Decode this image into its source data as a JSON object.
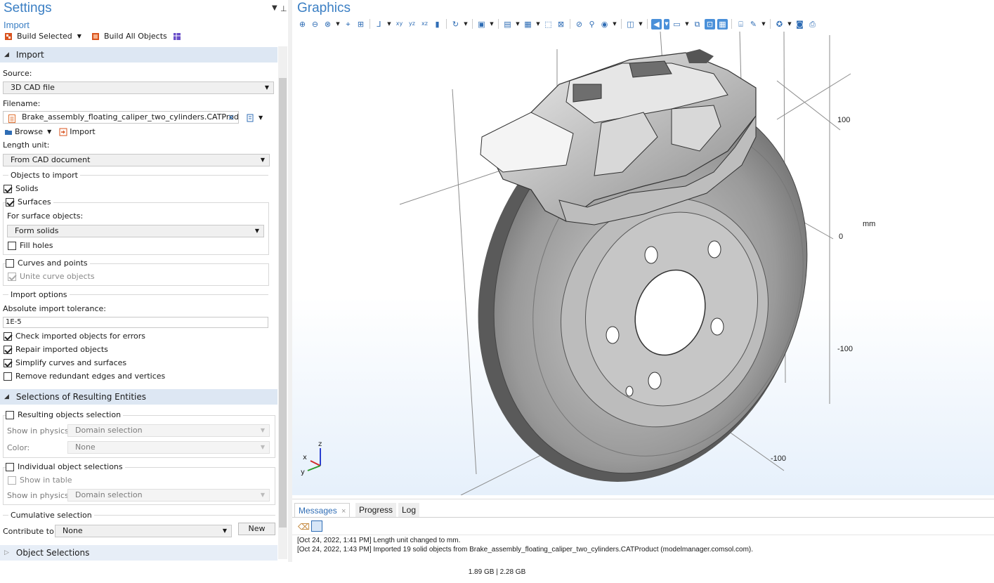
{
  "settings": {
    "title": "Settings",
    "subtitle": "Import",
    "toolbar": {
      "build_selected": "Build Selected",
      "build_all": "Build All Objects"
    },
    "import_section": "Import",
    "source_label": "Source:",
    "source_value": "3D CAD file",
    "filename_label": "Filename:",
    "filename_value": "Brake_assembly_floating_caliper_two_cylinders.CATProduct",
    "browse": "Browse",
    "import_btn": "Import",
    "length_unit_label": "Length unit:",
    "length_unit_value": "From CAD document",
    "objects_to_import": "Objects to import",
    "solids": "Solids",
    "surfaces": "Surfaces",
    "surface_objects_label": "For surface objects:",
    "surface_objects_value": "Form solids",
    "fill_holes": "Fill holes",
    "curves_points": "Curves and points",
    "unite_curves": "Unite curve objects",
    "import_options": "Import options",
    "tolerance_label": "Absolute import tolerance:",
    "tolerance_value": "1E-5",
    "check_errors": "Check imported objects for errors",
    "repair": "Repair imported objects",
    "simplify": "Simplify curves and surfaces",
    "remove_redundant": "Remove redundant edges and vertices",
    "selections_section": "Selections of Resulting Entities",
    "resulting_selection": "Resulting objects selection",
    "show_in_physics_label": "Show in physics:",
    "show_in_physics_value": "Domain selection",
    "color_label": "Color:",
    "color_value": "None",
    "individual_selections": "Individual object selections",
    "show_in_table": "Show in table",
    "show_in_physics_value2": "Domain selection",
    "cumulative": "Cumulative selection",
    "contribute_label": "Contribute to:",
    "contribute_value": "None",
    "new_btn": "New",
    "object_selections": "Object Selections"
  },
  "graphics": {
    "title": "Graphics",
    "axis_labels": {
      "z100": "100",
      "z0": "0",
      "zm100": "-100",
      "xm100": "-100",
      "unit": "mm"
    },
    "triad": {
      "x": "x",
      "y": "y",
      "z": "z"
    }
  },
  "messages": {
    "tabs": [
      "Messages",
      "Progress",
      "Log"
    ],
    "lines": [
      "[Oct 24, 2022, 1:41 PM] Length unit changed to mm.",
      "[Oct 24, 2022, 1:43 PM] Imported 19 solid objects from Brake_assembly_floating_caliper_two_cylinders.CATProduct (modelmanager.comsol.com)."
    ]
  },
  "status": {
    "memory": "1.89 GB | 2.28 GB"
  },
  "colors": {
    "accent": "#3b7fc4",
    "section_bg": "#dde7f3"
  }
}
